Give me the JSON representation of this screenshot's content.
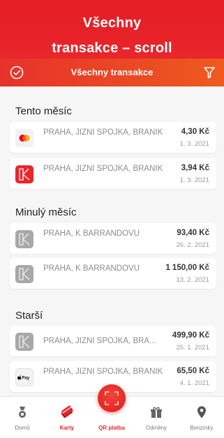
{
  "banner": {
    "line1": "Všechny",
    "line2": "transakce  – scroll"
  },
  "header": {
    "title": "Všechny transakce"
  },
  "sections": [
    {
      "title": "Tento měsíc",
      "rows": [
        {
          "place": "PRAHA, JIŽNÍ SPOJKA, BRANÍK",
          "amount": "4,30 Kč",
          "date": "1. 3. 2021",
          "logo": "mastercard-logo"
        },
        {
          "place": "PRAHA, JIŽNÍ SPOJKA, BRANÍK",
          "amount": "3,94 Kč",
          "date": "1. 3. 2021",
          "logo": "kp-red-logo"
        }
      ]
    },
    {
      "title": "Minulý měsíc",
      "rows": [
        {
          "place": "PRAHA, K BARRANDOVU",
          "amount": "93,40 Kč",
          "date": "26. 2. 2021",
          "logo": "kp-gray-logo"
        },
        {
          "place": "PRAHA, K BARRANDOVU",
          "amount": "1 150,00 Kč",
          "date": "13. 2. 2021",
          "logo": "kp-gray-logo"
        }
      ]
    },
    {
      "title": "Starší",
      "rows": [
        {
          "place": "PRAHA, JIŽNÍ SPOJKA, BRA...",
          "amount": "499,90 Kč",
          "date": "25. 1. 2021",
          "logo": "kp-gray-logo"
        },
        {
          "place": "PRAHA, JIŽNÍ SPOJKA, BRANÍK",
          "amount": "65,50 Kč",
          "date": "4. 1. 2021",
          "logo": "apple-pay-logo"
        }
      ]
    }
  ],
  "tabs": [
    {
      "label": "Domů",
      "icon": "medal-icon"
    },
    {
      "label": "Karty",
      "icon": "cards-icon"
    },
    {
      "label": "QR platba",
      "icon": "qr-scan-icon"
    },
    {
      "label": "Odměny",
      "icon": "gift-icon"
    },
    {
      "label": "Benzínky",
      "icon": "location-pin-icon"
    }
  ],
  "apple_pay_text": "Pay",
  "colors": {
    "brand_red": "#e8262b",
    "accent_orange": "#ee5a1f"
  }
}
